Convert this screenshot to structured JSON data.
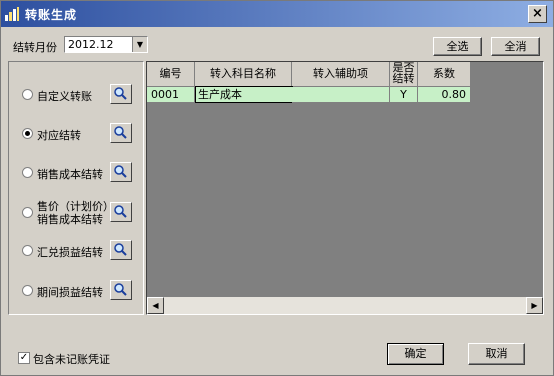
{
  "window": {
    "title": "转账生成",
    "close_glyph": "×"
  },
  "period": {
    "label": "结转月份",
    "value": "2012.12"
  },
  "buttons": {
    "select_all": "全选",
    "clear_all": "全消",
    "ok": "确定",
    "cancel": "取消"
  },
  "options": [
    {
      "label": "自定义转账",
      "checked": false
    },
    {
      "label": "对应结转",
      "checked": true
    },
    {
      "label": "销售成本结转",
      "checked": false
    },
    {
      "label_line1": "售价（计划价）",
      "label_line2": "销售成本结转",
      "checked": false
    },
    {
      "label": "汇兑损益结转",
      "checked": false
    },
    {
      "label": "期间损益结转",
      "checked": false
    }
  ],
  "table": {
    "headers": {
      "code": "编号",
      "account": "转入科目名称",
      "aux": "转入辅助项",
      "carry_line1": "是否",
      "carry_line2": "结转",
      "coef": "系数"
    },
    "rows": [
      {
        "code": "0001",
        "account": "生产成本",
        "aux": "",
        "carry": "Y",
        "coef": "0.80"
      }
    ]
  },
  "footer": {
    "include_unposted_label": "包含未记账凭证",
    "include_unposted_checked": true
  }
}
